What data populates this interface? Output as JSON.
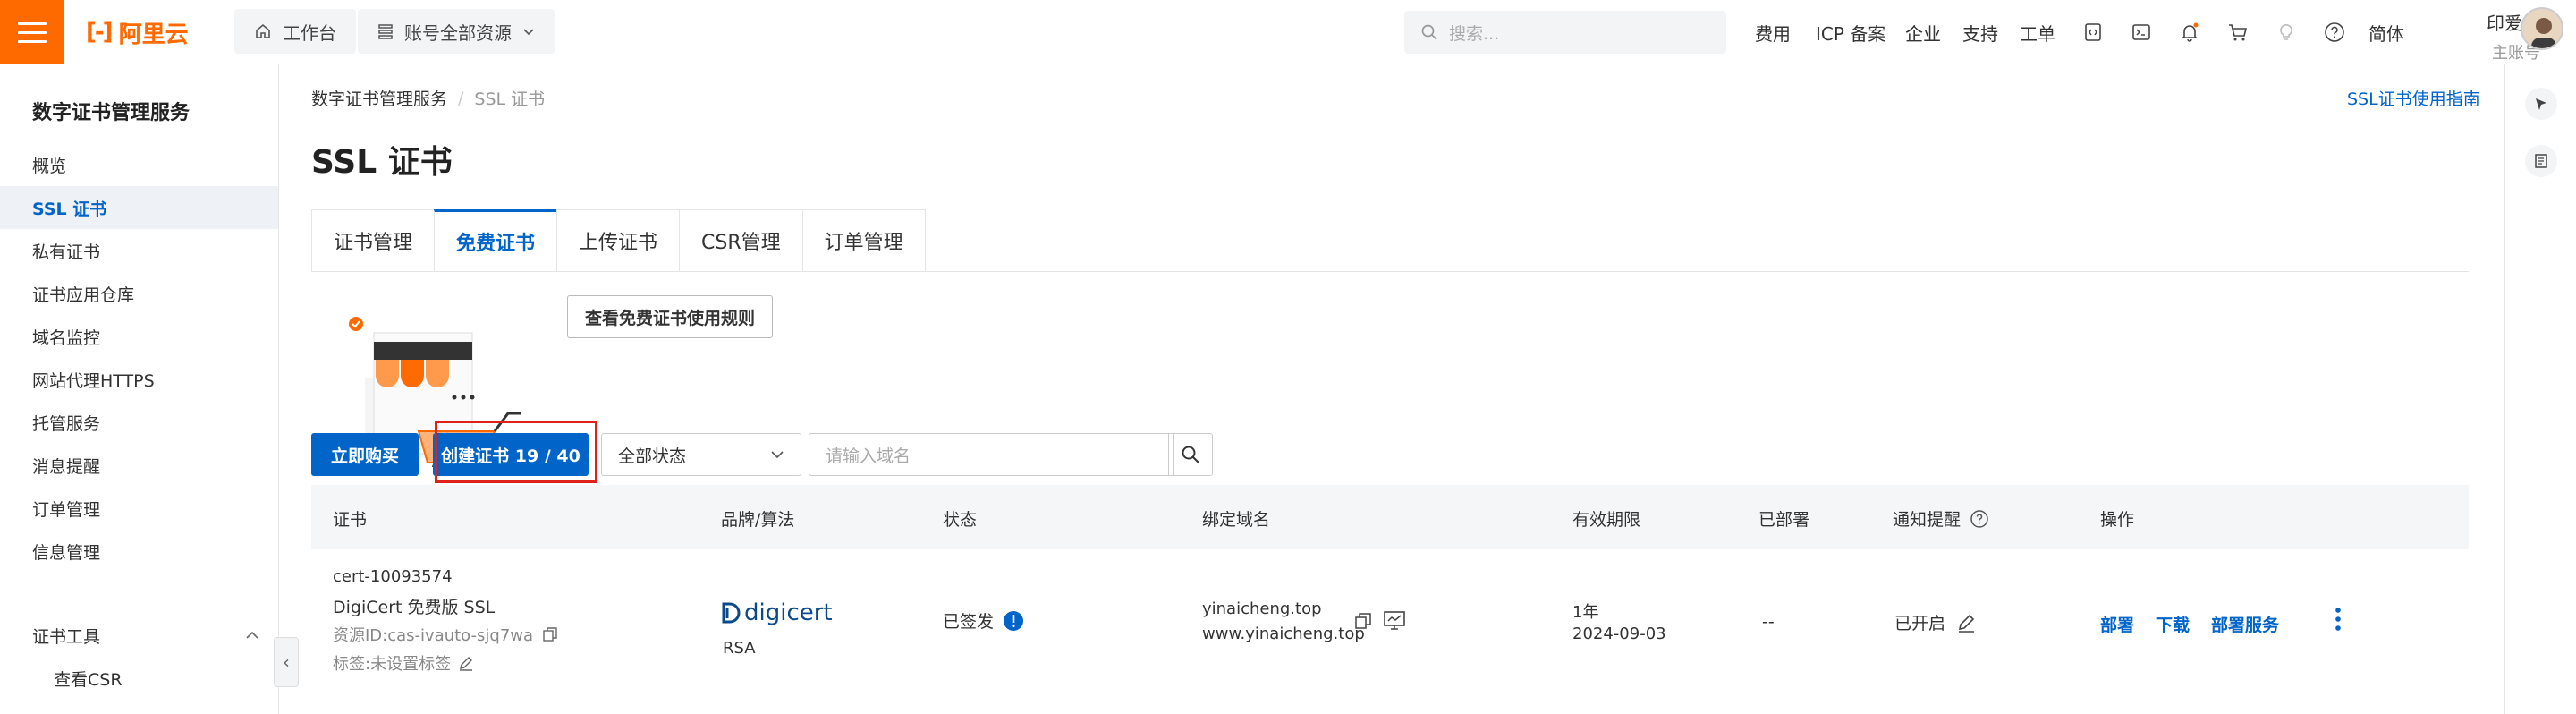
{
  "header": {
    "logo_text": "阿里云",
    "workbench": "工作台",
    "account_resources": "账号全部资源",
    "search_placeholder": "搜索...",
    "nav": [
      "费用",
      "ICP 备案",
      "企业",
      "支持",
      "工单"
    ],
    "language": "简体",
    "user_name": "印爱成",
    "user_role": "主账号",
    "icons": [
      "code-icon",
      "terminal-icon",
      "bell-icon",
      "cart-icon",
      "bulb-icon",
      "help-icon"
    ]
  },
  "sidebar": {
    "title": "数字证书管理服务",
    "items": [
      {
        "label": "概览",
        "active": false
      },
      {
        "label": "SSL 证书",
        "active": true
      },
      {
        "label": "私有证书",
        "active": false
      },
      {
        "label": "证书应用仓库",
        "active": false
      },
      {
        "label": "域名监控",
        "active": false
      },
      {
        "label": "网站代理HTTPS",
        "active": false
      },
      {
        "label": "托管服务",
        "active": false
      },
      {
        "label": "消息提醒",
        "active": false
      },
      {
        "label": "订单管理",
        "active": false
      },
      {
        "label": "信息管理",
        "active": false
      }
    ],
    "tools_title": "证书工具",
    "tools_items": [
      "查看CSR"
    ]
  },
  "main": {
    "breadcrumb": [
      "数字证书管理服务",
      "SSL 证书"
    ],
    "help_link": "SSL证书使用指南",
    "title": "SSL 证书",
    "tabs": [
      {
        "label": "证书管理",
        "active": false
      },
      {
        "label": "免费证书",
        "active": true
      },
      {
        "label": "上传证书",
        "active": false
      },
      {
        "label": "CSR管理",
        "active": false
      },
      {
        "label": "订单管理",
        "active": false
      }
    ],
    "rules_button": "查看免费证书使用规则",
    "buy_button": "立即购买",
    "create_button": "创建证书 19 / 40",
    "status_select": "全部状态",
    "domain_placeholder": "请输入域名"
  },
  "table": {
    "headers": [
      "证书",
      "品牌/算法",
      "状态",
      "绑定域名",
      "有效期限",
      "已部署",
      "通知提醒",
      "操作"
    ],
    "rows": [
      {
        "cert_id": "cert-10093574",
        "cert_name": "DigiCert 免费版 SSL",
        "resource_id": "资源ID:cas-ivauto-sjq7wa",
        "tags": "标签:未设置标签",
        "brand": "digicert",
        "algorithm": "RSA",
        "status": "已签发",
        "domains": [
          "yinaicheng.top",
          "www.yinaicheng.top"
        ],
        "validity": "1年",
        "expiry": "2024-09-03",
        "deployed": "--",
        "notify": "已开启",
        "actions": [
          "部署",
          "下载",
          "部署服务"
        ]
      }
    ]
  },
  "colors": {
    "brand_orange": "#ff6a00",
    "primary_blue": "#0064c8",
    "highlight_red": "#e0211a"
  }
}
